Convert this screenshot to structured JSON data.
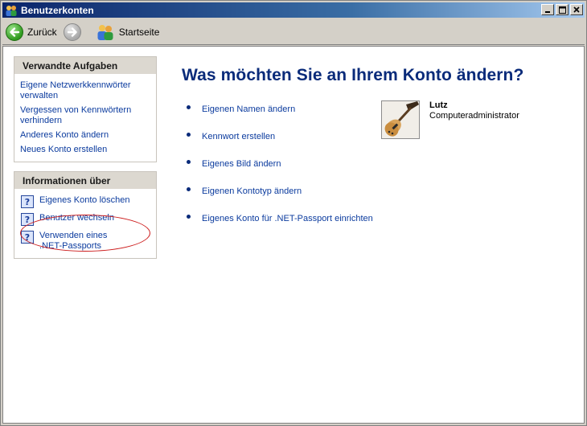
{
  "window": {
    "title": "Benutzerkonten",
    "icon": "users-icon",
    "controls": [
      "minimize",
      "maximize",
      "close"
    ]
  },
  "toolbar": {
    "back_label": "Zurück",
    "forward_icon": "forward-arrow-icon",
    "home_label": "Startseite"
  },
  "sidebar": {
    "related_tasks": {
      "header": "Verwandte Aufgaben",
      "items": [
        "Eigene Netzwerkkennwörter verwalten",
        "Vergessen von Kennwörtern verhindern",
        "Anderes Konto ändern",
        "Neues Konto erstellen"
      ]
    },
    "info": {
      "header": "Informationen über",
      "items": [
        "Eigenes Konto löschen",
        "Benutzer wechseln",
        "Verwenden eines .NET-Passports"
      ]
    }
  },
  "main": {
    "title": "Was möchten Sie an Ihrem Konto ändern?",
    "tasks": [
      "Eigenen Namen ändern",
      "Kennwort erstellen",
      "Eigenes Bild ändern",
      "Eigenen Kontotyp ändern",
      "Eigenes Konto für .NET-Passport einrichten"
    ]
  },
  "user": {
    "name": "Lutz",
    "role": "Computeradministrator",
    "avatar": "guitar-picture"
  },
  "colors": {
    "title_blue": "#0a2b7a",
    "link_blue": "#0b3b9e",
    "annotation_red": "#cc1a1a"
  }
}
